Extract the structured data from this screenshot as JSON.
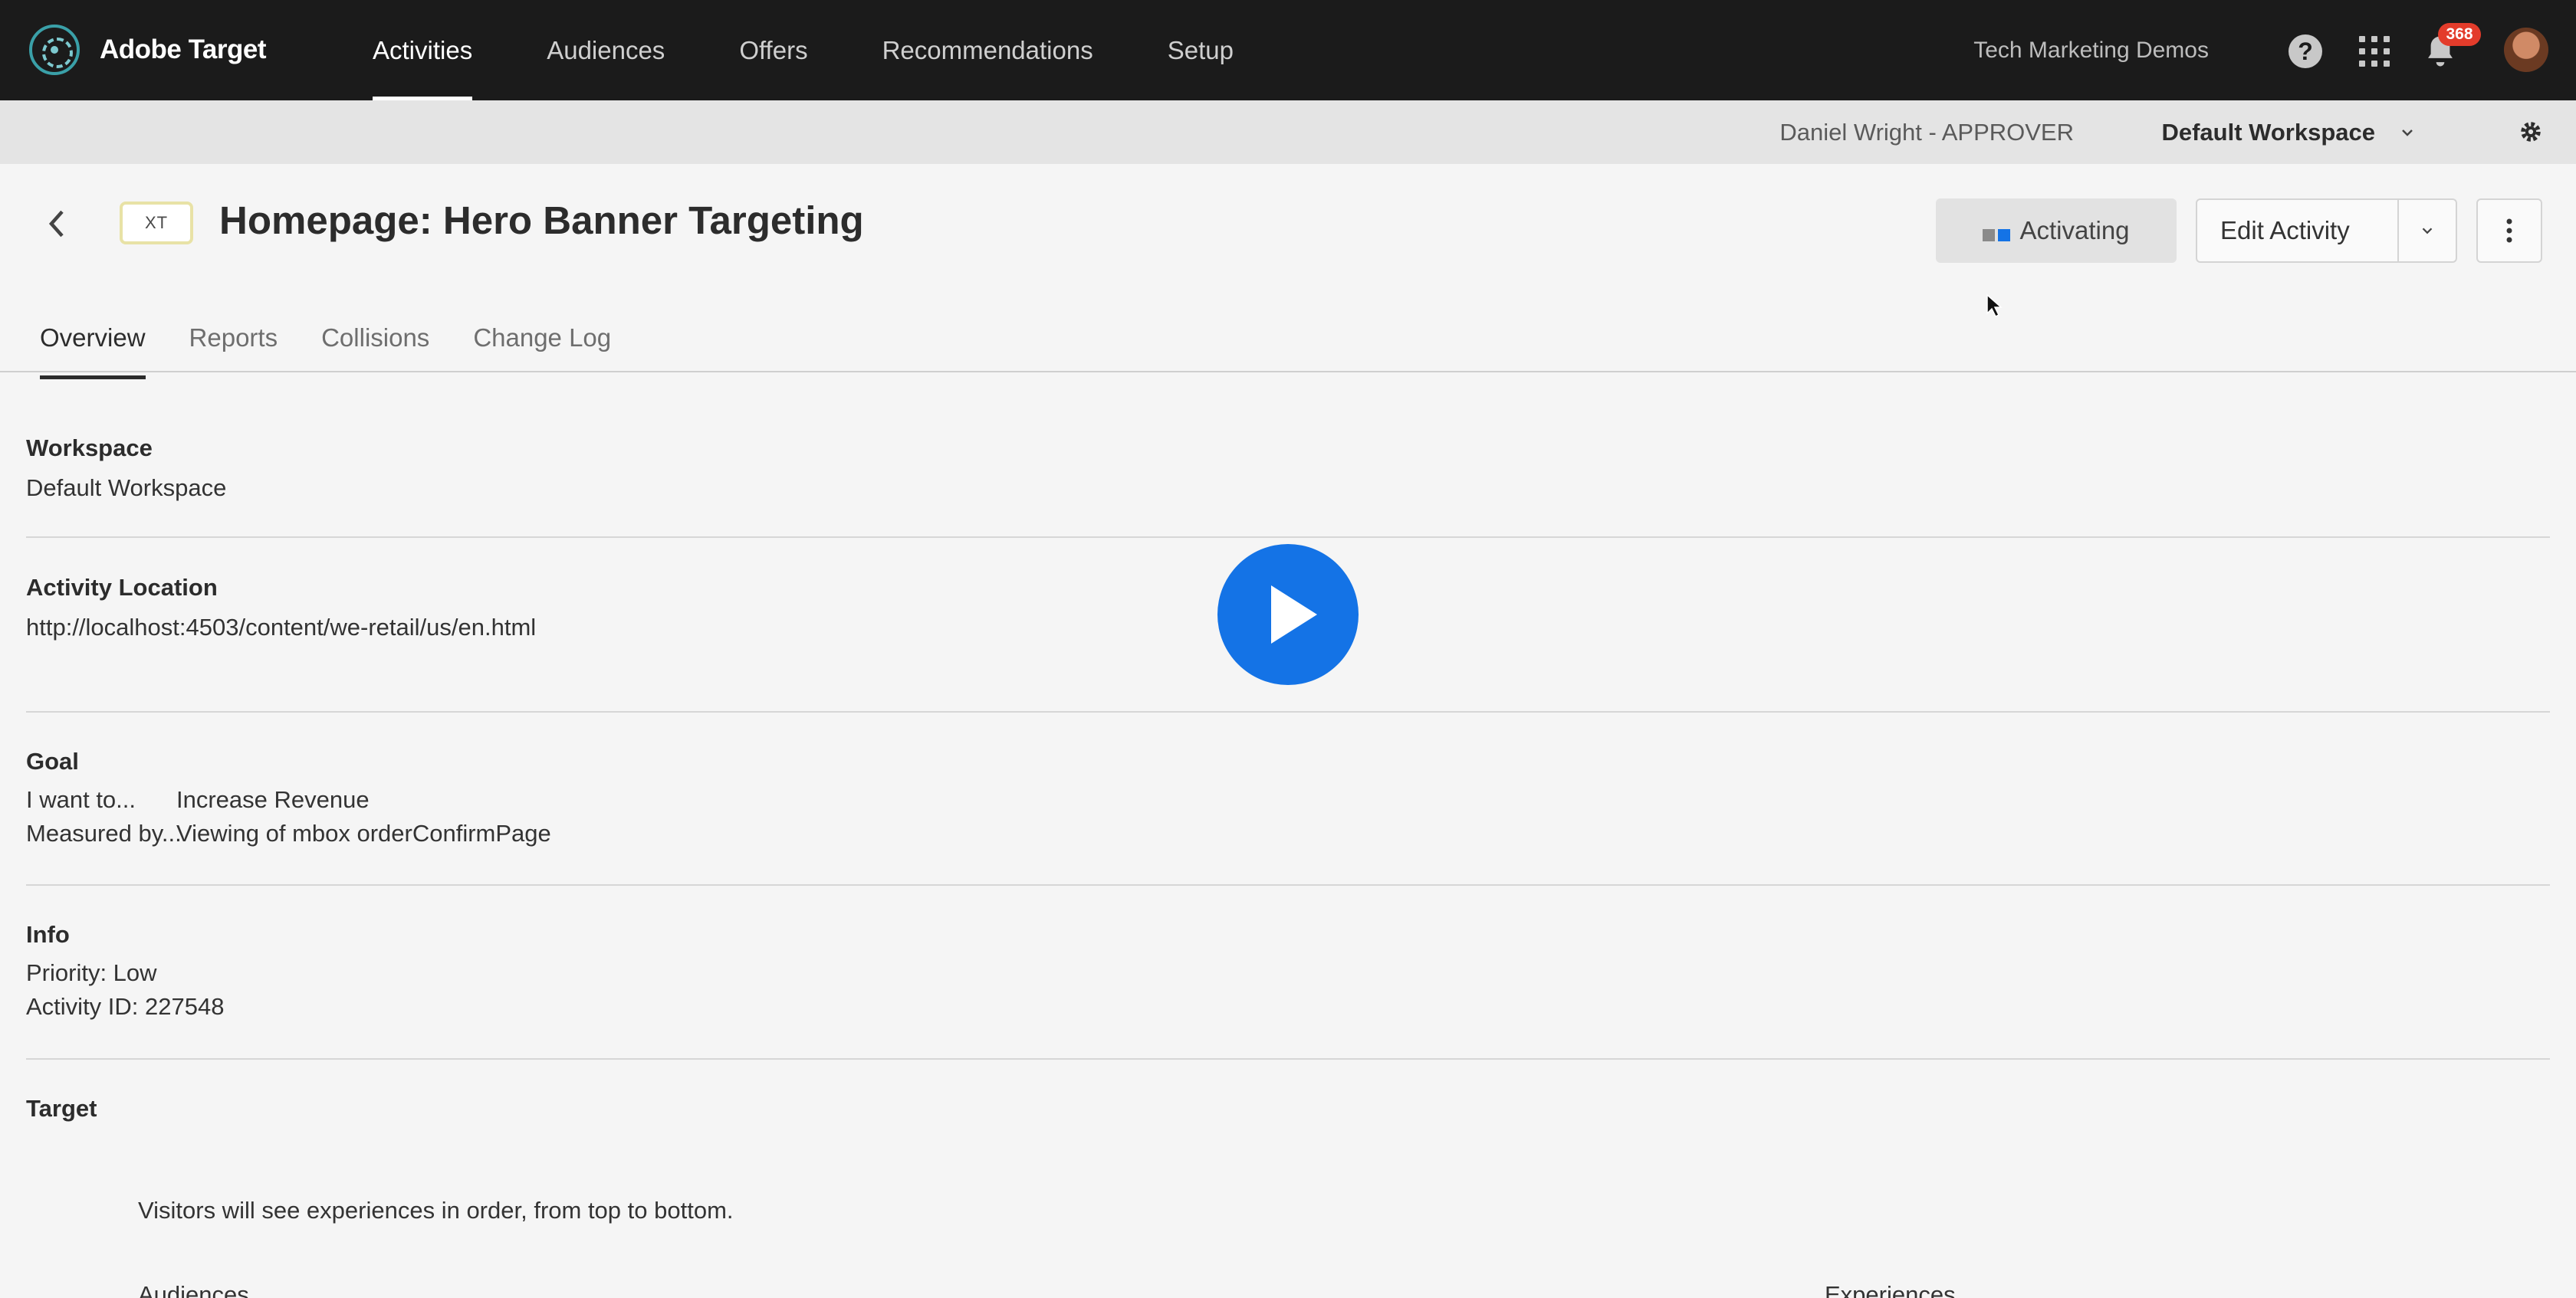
{
  "app": {
    "name": "Adobe Target"
  },
  "topnav": {
    "items": [
      "Activities",
      "Audiences",
      "Offers",
      "Recommendations",
      "Setup"
    ],
    "active": "Activities",
    "org": "Tech Marketing Demos",
    "notification_count": "368"
  },
  "subbar": {
    "user_role": "Daniel Wright - APPROVER",
    "workspace": "Default Workspace"
  },
  "activity": {
    "type_badge": "XT",
    "title": "Homepage: Hero Banner Targeting",
    "status": "Activating",
    "edit_label": "Edit Activity"
  },
  "tabs": [
    "Overview",
    "Reports",
    "Collisions",
    "Change Log"
  ],
  "overview": {
    "workspace": {
      "heading": "Workspace",
      "value": "Default Workspace"
    },
    "location": {
      "heading": "Activity Location",
      "value": "http://localhost:4503/content/we-retail/us/en.html"
    },
    "goal": {
      "heading": "Goal",
      "want_label": "I want to...",
      "want_value": "Increase Revenue",
      "measured_label": "Measured by...",
      "measured_value": "Viewing of mbox orderConfirmPage"
    },
    "info": {
      "heading": "Info",
      "priority": "Priority: Low",
      "activity_id": "Activity ID: 227548"
    },
    "target": {
      "heading": "Target",
      "order_note": "Visitors will see experiences in order, from top to bottom.",
      "audiences_col": "Audiences",
      "experiences_col": "Experiences"
    }
  },
  "colors": {
    "nav_bg": "#1b1b1b",
    "accent_blue": "#1473e6",
    "badge_red": "#e33c2b",
    "status_dot_grey": "#8a8a8a",
    "status_dot_blue": "#1473e6"
  },
  "icons": [
    "adobe-target-logo-icon",
    "help-icon",
    "apps-grid-icon",
    "bell-icon",
    "avatar",
    "chevron-down-icon",
    "gear-icon",
    "back-chevron-icon",
    "more-vertical-icon",
    "play-icon",
    "mouse-cursor-icon"
  ]
}
